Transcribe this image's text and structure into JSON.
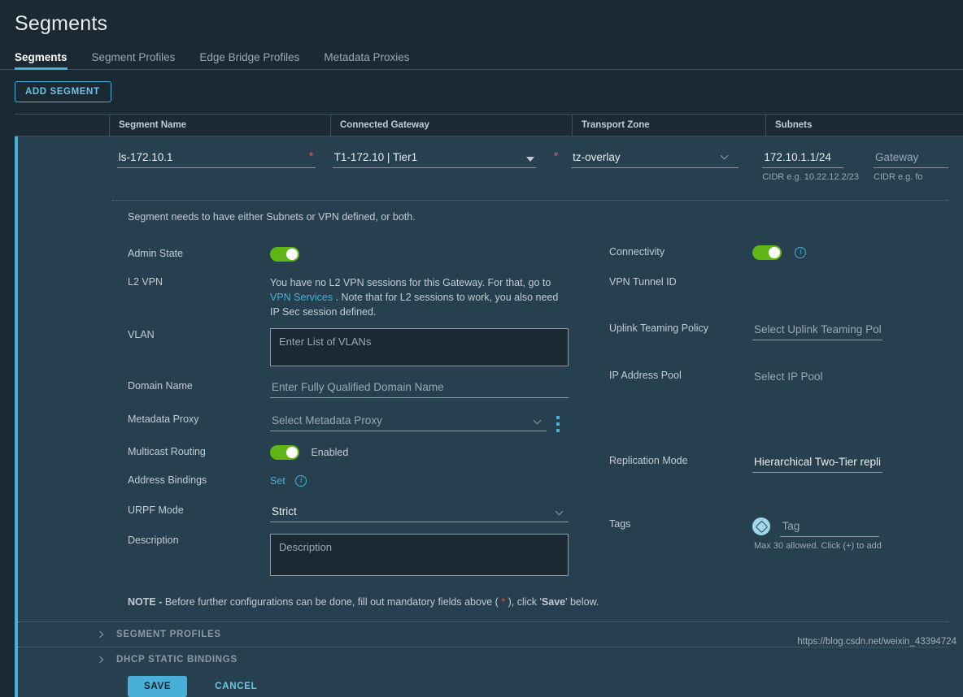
{
  "header": {
    "title": "Segments",
    "tabs": [
      {
        "label": "Segments",
        "active": true
      },
      {
        "label": "Segment Profiles",
        "active": false
      },
      {
        "label": "Edge Bridge Profiles",
        "active": false
      },
      {
        "label": "Metadata Proxies",
        "active": false
      }
    ]
  },
  "toolbar": {
    "add_segment_label": "ADD SEGMENT"
  },
  "table": {
    "columns": [
      "Segment Name",
      "Connected Gateway",
      "Transport Zone",
      "Subnets"
    ],
    "row": {
      "segment_name": "ls-172.10.1",
      "connected_gateway": "T1-172.10 | Tier1",
      "transport_zone": "tz-overlay",
      "subnet_cidr": "172.10.1.1/24",
      "subnet_hint": "CIDR e.g. 10.22.12.2/23",
      "gateway_label": "Gateway",
      "gateway_hint": "CIDR e.g. fo",
      "required_marker": "*"
    }
  },
  "notice": "Segment needs to have either Subnets or VPN defined, or both.",
  "form_left": {
    "admin_state": {
      "label": "Admin State",
      "state": "on"
    },
    "l2vpn": {
      "label": "L2 VPN",
      "text_before": "You have no L2 VPN sessions for this Gateway. For that, go to ",
      "link": "VPN Services",
      "text_after": " . Note that for L2 sessions to work, you also need IP Sec session defined."
    },
    "vlan": {
      "label": "VLAN",
      "placeholder": "Enter List of VLANs",
      "value": ""
    },
    "domain_name": {
      "label": "Domain Name",
      "placeholder": "Enter Fully Qualified Domain Name",
      "value": ""
    },
    "metadata_proxy": {
      "label": "Metadata Proxy",
      "placeholder": "Select Metadata Proxy",
      "value": "",
      "menu_icon": "kebab-menu-icon"
    },
    "multicast_routing": {
      "label": "Multicast Routing",
      "state": "on",
      "state_text": "Enabled"
    },
    "address_bindings": {
      "label": "Address Bindings",
      "action": "Set",
      "info_icon": "info-icon"
    },
    "urpf_mode": {
      "label": "URPF Mode",
      "value": "Strict"
    },
    "description": {
      "label": "Description",
      "placeholder": "Description",
      "value": ""
    }
  },
  "form_right": {
    "connectivity": {
      "label": "Connectivity",
      "state": "on",
      "info_icon": "info-icon"
    },
    "vpn_tunnel_id": {
      "label": "VPN Tunnel ID",
      "value": ""
    },
    "uplink_teaming_policy": {
      "label": "Uplink Teaming Policy",
      "placeholder": "Select Uplink Teaming Poli",
      "value": ""
    },
    "ip_address_pool": {
      "label": "IP Address Pool",
      "placeholder": "Select IP Pool",
      "value": ""
    },
    "replication_mode": {
      "label": "Replication Mode",
      "value": "Hierarchical Two-Tier replic"
    },
    "tags": {
      "label": "Tags",
      "placeholder": "Tag",
      "value": "",
      "hint": "Max 30 allowed. Click (+) to add",
      "icon": "tag-icon"
    }
  },
  "note": {
    "bold_prefix": "NOTE -",
    "text_1": " Before further configurations can be done, fill out mandatory fields above ( ",
    "star": "*",
    "text_2": " ), click '",
    "bold_save": "Save",
    "text_3": "' below."
  },
  "accordions": [
    {
      "label": "SEGMENT PROFILES",
      "icon": "chevron-right-icon"
    },
    {
      "label": "DHCP STATIC BINDINGS",
      "icon": "chevron-right-icon"
    }
  ],
  "footer": {
    "save_label": "SAVE",
    "cancel_label": "CANCEL"
  },
  "watermark": "https://blog.csdn.net/weixin_43394724",
  "colors": {
    "page_bg": "#1b2a32",
    "panel_bg": "#27404f",
    "accent": "#49afd9",
    "toggle_on": "#60b515",
    "required": "#f54f47"
  }
}
